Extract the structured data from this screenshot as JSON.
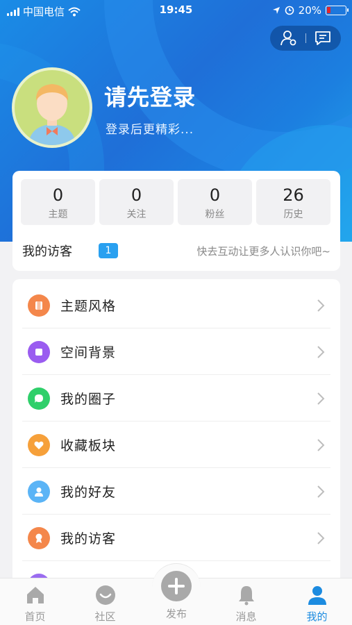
{
  "status_bar": {
    "carrier": "中国电信",
    "time": "19:45",
    "battery": "20%",
    "battery_level": 0.2
  },
  "profile": {
    "title": "请先登录",
    "subtitle": "登录后更精彩..."
  },
  "stats": [
    {
      "value": "0",
      "label": "主题"
    },
    {
      "value": "0",
      "label": "关注"
    },
    {
      "value": "0",
      "label": "粉丝"
    },
    {
      "value": "26",
      "label": "历史"
    }
  ],
  "visitors": {
    "label": "我的访客",
    "count": "1",
    "hint": "快去互动让更多人认识你吧~"
  },
  "menu": [
    {
      "label": "主题风格",
      "icon": "theme-icon",
      "color": "#f4874b"
    },
    {
      "label": "空间背景",
      "icon": "background-icon",
      "color": "#9a5cf0"
    },
    {
      "label": "我的圈子",
      "icon": "circle-chat-icon",
      "color": "#2fcf6a"
    },
    {
      "label": "收藏板块",
      "icon": "heart-icon",
      "color": "#f6a03a"
    },
    {
      "label": "我的好友",
      "icon": "friend-icon",
      "color": "#5bb4f6"
    },
    {
      "label": "我的访客",
      "icon": "visitor-icon",
      "color": "#f4874b"
    },
    {
      "label": "",
      "icon": "more-icon",
      "color": "#9a6cf0"
    }
  ],
  "tabbar": [
    {
      "label": "首页",
      "icon": "home-icon",
      "active": false
    },
    {
      "label": "社区",
      "icon": "community-icon",
      "active": false
    },
    {
      "label": "发布",
      "icon": "plus-icon",
      "active": false
    },
    {
      "label": "消息",
      "icon": "bell-icon",
      "active": false
    },
    {
      "label": "我的",
      "icon": "profile-icon",
      "active": true
    }
  ],
  "colors": {
    "accent": "#1c8be0",
    "badge": "#29a0f0",
    "battery_low": "#e5262b"
  }
}
